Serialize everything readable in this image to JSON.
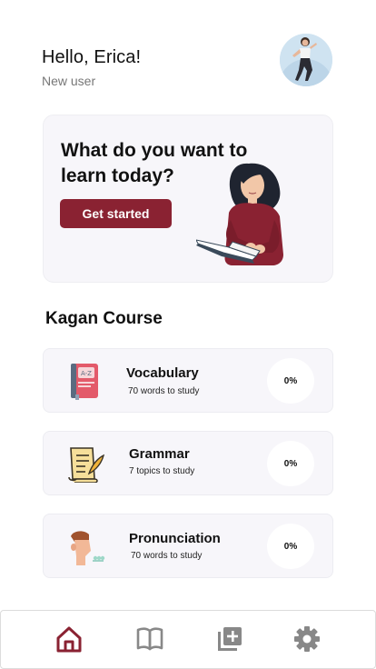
{
  "header": {
    "greeting": "Hello, Erica!",
    "subtitle": "New user",
    "avatar_icon": "user-avatar"
  },
  "hero": {
    "title": "What do you want to learn today?",
    "button_label": "Get started",
    "illustration": "woman-reading-book-icon"
  },
  "section": {
    "title": "Kagan Course"
  },
  "courses": [
    {
      "name": "Vocabulary",
      "subtitle": "70 words to study",
      "progress": "0%",
      "icon": "dictionary-book-icon"
    },
    {
      "name": "Grammar",
      "subtitle": "7 topics to study",
      "progress": "0%",
      "icon": "scroll-quill-icon"
    },
    {
      "name": "Pronunciation",
      "subtitle": "70 words to study",
      "progress": "0%",
      "icon": "speaking-person-icon"
    }
  ],
  "nav": {
    "items": [
      "home-icon",
      "book-icon",
      "add-library-icon",
      "settings-gear-icon"
    ],
    "active": "home-icon"
  },
  "colors": {
    "accent": "#8a2232",
    "inactive": "#888888",
    "card_bg": "#f7f6fa"
  }
}
